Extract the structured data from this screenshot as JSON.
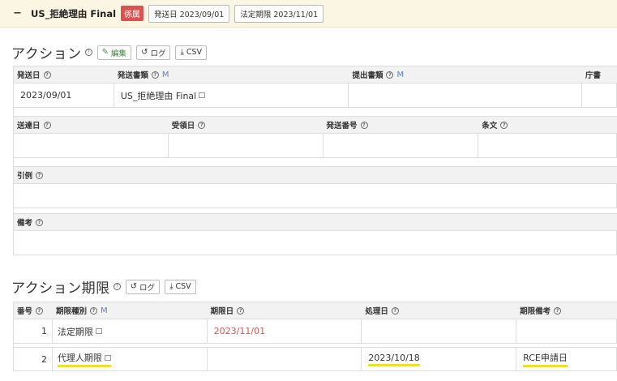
{
  "header": {
    "matter_title": "US_拒絶理由 Final",
    "status_badge": "係属",
    "send_date_pill": "発送日 2023/09/01",
    "deadline_pill": "法定期限 2023/11/01"
  },
  "action_section": {
    "title": "アクション",
    "edit_label": "編集",
    "log_label": "ログ",
    "csv_label": "CSV",
    "row1_headers": [
      "発送日",
      "発送書類",
      "提出書類",
      "庁書"
    ],
    "row1_values": [
      "2023/09/01",
      "US_拒絶理由 Final",
      "",
      ""
    ],
    "row2_headers": [
      "送達日",
      "受領日",
      "発送番号",
      "条文"
    ],
    "row2_values": [
      "",
      "",
      "",
      ""
    ],
    "citation_label": "引例",
    "citation_value": "",
    "remarks_label": "備考",
    "remarks_value": ""
  },
  "deadline_section": {
    "title": "アクション期限",
    "log_label": "ログ",
    "csv_label": "CSV",
    "columns": [
      "番号",
      "期限種別",
      "期限日",
      "処理日",
      "期限備考"
    ],
    "rows": [
      {
        "no": "1",
        "type": "法定期限",
        "due": "2023/11/01",
        "done": "",
        "note": ""
      },
      {
        "no": "2",
        "type": "代理人期限",
        "due": "",
        "done": "2023/10/18",
        "note": "RCE申請日"
      }
    ]
  },
  "colors": {
    "topbar_bg": "#fbf6e4",
    "badge_red": "#d9534f",
    "highlight": "#fff200",
    "m_blue": "#5b7fc7"
  }
}
